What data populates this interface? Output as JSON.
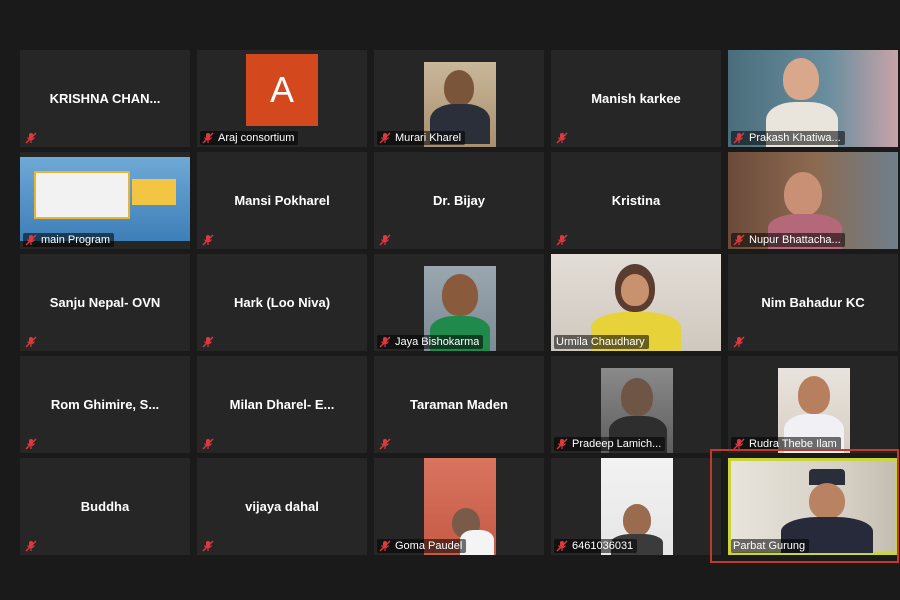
{
  "meeting": {
    "participants": [
      {
        "name": "KRISHNA  CHAN...",
        "mode": "name",
        "muted": true
      },
      {
        "name": "Araj consortium",
        "mode": "avatar",
        "avatar_letter": "A",
        "avatar_color": "#d4481e",
        "muted": true
      },
      {
        "name": "Murari Kharel",
        "mode": "video",
        "muted": true
      },
      {
        "name": "Manish karkee",
        "mode": "name",
        "muted": true
      },
      {
        "name": "Prakash Khatiwa...",
        "mode": "video",
        "muted": true
      },
      {
        "name": "main Program",
        "mode": "video",
        "muted": true
      },
      {
        "name": "Mansi Pokharel",
        "mode": "name",
        "muted": true
      },
      {
        "name": "Dr. Bijay",
        "mode": "name",
        "muted": true
      },
      {
        "name": "Kristina",
        "mode": "name",
        "muted": true
      },
      {
        "name": "Nupur Bhattacha...",
        "mode": "video",
        "muted": true
      },
      {
        "name": "Sanju Nepal- OVN",
        "mode": "name",
        "muted": true
      },
      {
        "name": "Hark (Loo Niva)",
        "mode": "name",
        "muted": true
      },
      {
        "name": "Jaya Bishokarma",
        "mode": "video",
        "muted": true
      },
      {
        "name": "Urmila Chaudhary",
        "mode": "video",
        "muted": false
      },
      {
        "name": "Nim Bahadur KC",
        "mode": "name",
        "muted": true
      },
      {
        "name": "Rom  Ghimire, S...",
        "mode": "name",
        "muted": true
      },
      {
        "name": "Milan  Dharel-  E...",
        "mode": "name",
        "muted": true
      },
      {
        "name": "Taraman Maden",
        "mode": "name",
        "muted": true
      },
      {
        "name": "Pradeep Lamich...",
        "mode": "video",
        "muted": true
      },
      {
        "name": "Rudra Thebe Ilam",
        "mode": "video",
        "muted": true
      },
      {
        "name": "Buddha",
        "mode": "name",
        "muted": true
      },
      {
        "name": "vijaya dahal",
        "mode": "name",
        "muted": true
      },
      {
        "name": "Goma Paudel",
        "mode": "video",
        "muted": true
      },
      {
        "name": "6461036031",
        "mode": "video",
        "muted": true
      },
      {
        "name": "Parbat Gurung",
        "mode": "video",
        "muted": false,
        "active_speaker": true
      }
    ],
    "colors": {
      "background": "#1a1a1a",
      "tile": "#262626",
      "active_speaker": "#c9d53a",
      "highlight": "#c0392b",
      "muted_icon": "#e0383e"
    }
  }
}
